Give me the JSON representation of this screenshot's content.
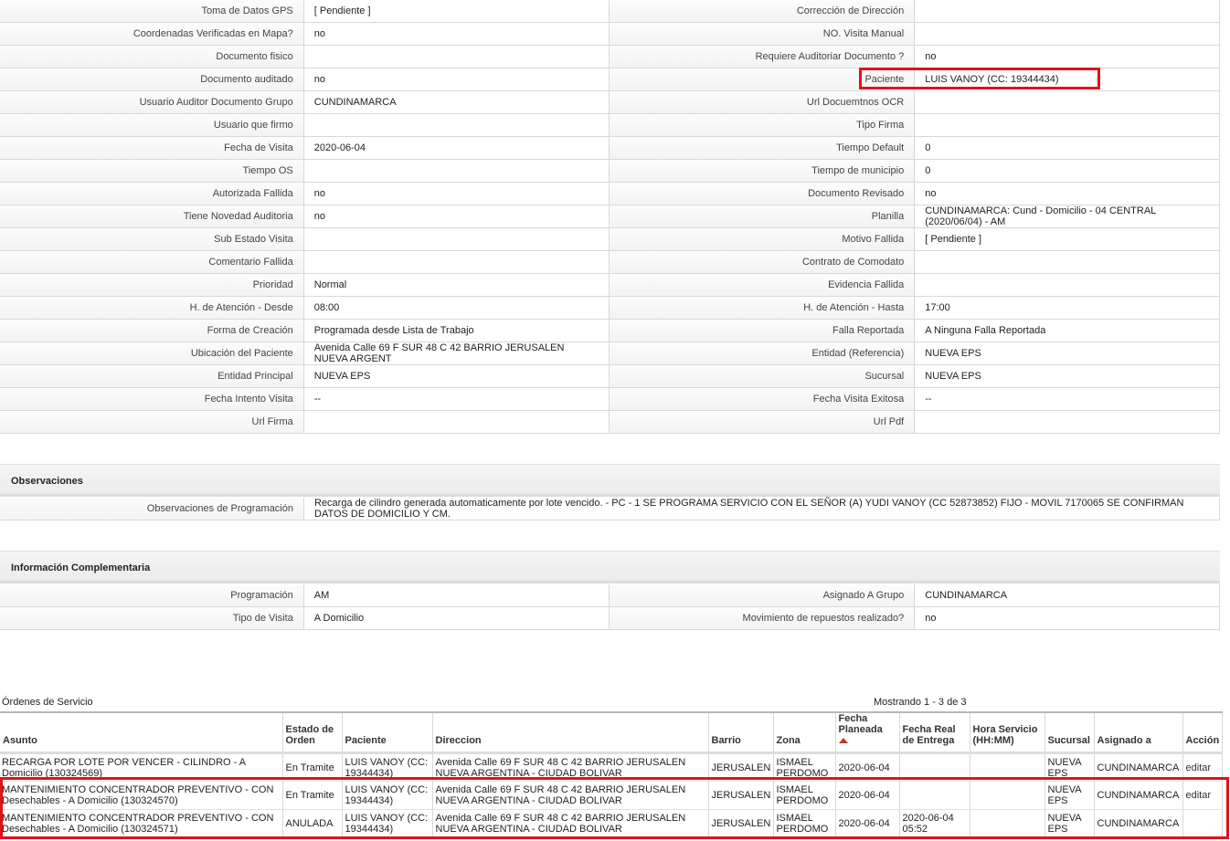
{
  "detail_rows": [
    {
      "l1": "Toma de Datos GPS",
      "v1": "[ Pendiente ]",
      "l2": "Corrección de Dirección",
      "v2": ""
    },
    {
      "l1": "Coordenadas Verificadas en Mapa?",
      "v1": " no",
      "l2": "NO. Visita Manual",
      "v2": ""
    },
    {
      "l1": "Documento fisico",
      "v1": "",
      "l2": "Requiere Auditoriar Documento ?",
      "v2": " no"
    },
    {
      "l1": "Documento auditado",
      "v1": " no",
      "l2": "Paciente",
      "v2": "LUIS VANOY (CC: 19344434)"
    },
    {
      "l1": "Usuario Auditor Documento Grupo",
      "v1": "CUNDINAMARCA",
      "l2": "Url Docuemtnos OCR",
      "v2": ""
    },
    {
      "l1": "Usuario que firmo",
      "v1": "",
      "l2": "Tipo Firma",
      "v2": ""
    },
    {
      "l1": "Fecha de Visita",
      "v1": " 2020-06-04",
      "l2": "Tiempo Default",
      "v2": "0"
    },
    {
      "l1": "Tiempo OS",
      "v1": "",
      "l2": "Tiempo de municipio",
      "v2": "0"
    },
    {
      "l1": "Autorizada Fallida",
      "v1": " no",
      "l2": "Documento Revisado",
      "v2": " no"
    },
    {
      "l1": "Tiene Novedad Auditoria",
      "v1": " no",
      "l2": "Planilla",
      "v2": "CUNDINAMARCA: Cund - Domicilio - 04 CENTRAL\n(2020/06/04) - AM"
    },
    {
      "l1": "Sub Estado Visita",
      "v1": "",
      "l2": "Motivo Fallida",
      "v2": "[ Pendiente ]"
    },
    {
      "l1": "Comentario Fallida",
      "v1": "",
      "l2": "Contrato de Comodato",
      "v2": ""
    },
    {
      "l1": "Prioridad",
      "v1": "Normal",
      "l2": "Evidencia Fallida",
      "v2": ""
    },
    {
      "l1": "H. de Atención - Desde",
      "v1": "08:00",
      "l2": "H. de Atención - Hasta",
      "v2": "17:00"
    },
    {
      "l1": "Forma de Creación",
      "v1": "Programada desde Lista de Trabajo",
      "l2": "Falla Reportada",
      "v2": "A Ninguna Falla Reportada"
    },
    {
      "l1": "Ubicación del Paciente",
      "v1": "Avenida Calle 69 F SUR 48 C 42 BARRIO JERUSALEN\nNUEVA ARGENT",
      "l2": "Entidad (Referencia)",
      "v2": "NUEVA EPS"
    },
    {
      "l1": "Entidad Principal",
      "v1": "NUEVA EPS",
      "l2": "Sucursal",
      "v2": "NUEVA EPS"
    },
    {
      "l1": "Fecha Intento Visita",
      "v1": " --",
      "l2": "Fecha Visita Exitosa",
      "v2": " --"
    },
    {
      "l1": "Url Firma",
      "v1": "",
      "l2": "Url Pdf",
      "v2": ""
    }
  ],
  "observaciones": {
    "title": "Observaciones",
    "label": "Observaciones de Programación",
    "value": "   Recarga de cilindro generada automaticamente por lote vencido. - PC - 1 SE PROGRAMA SERVICIO CON EL SEÑOR (A) YUDI VANOY (CC 52873852) FIJO - MOVIL 7170065 SE CONFIRMAN DATOS DE DOMICILIO Y CM."
  },
  "complementaria": {
    "title": "Información Complementaria",
    "rows": [
      {
        "l1": "Programación",
        "v1": "AM",
        "l2": "Asignado A Grupo",
        "v2": "CUNDINAMARCA"
      },
      {
        "l1": "Tipo de Visita",
        "v1": "A Domicilio",
        "l2": "Movimiento de repuestos realizado?",
        "v2": " no"
      }
    ]
  },
  "orders": {
    "title": "Órdenes de Servicio",
    "count_text": "Mostrando 1 - 3 de 3",
    "columns": [
      "Asunto",
      "Estado de Orden",
      "Paciente",
      "Direccion",
      "Barrio",
      "Zona",
      "Fecha Planeada",
      "Fecha Real de Entrega",
      "Hora Servicio (HH:MM)",
      "Sucursal",
      "Asignado a",
      "Acción"
    ],
    "rows": [
      {
        "asunto": "RECARGA POR LOTE POR VENCER - CILINDRO - A Domicilio (130324569)",
        "estado": "En Tramite",
        "paciente": "LUIS VANOY (CC: 19344434)",
        "direccion": "Avenida Calle 69 F SUR 48 C 42 BARRIO JERUSALEN NUEVA ARGENTINA - CIUDAD BOLIVAR",
        "barrio": "JERUSALEN",
        "zona": "ISMAEL PERDOMO",
        "fecha_planeada": "2020-06-04",
        "fecha_real": "",
        "hora": "",
        "sucursal": "NUEVA EPS",
        "asignado": "CUNDINAMARCA",
        "accion": "editar"
      },
      {
        "asunto": "MANTENIMIENTO CONCENTRADOR PREVENTIVO - CON Desechables - A Domicilio (130324570)",
        "estado": "En Tramite",
        "paciente": "LUIS VANOY (CC: 19344434)",
        "direccion": "Avenida Calle 69 F SUR 48 C 42 BARRIO JERUSALEN NUEVA ARGENTINA - CIUDAD BOLIVAR",
        "barrio": "JERUSALEN",
        "zona": "ISMAEL PERDOMO",
        "fecha_planeada": "2020-06-04",
        "fecha_real": "",
        "hora": "",
        "sucursal": "NUEVA EPS",
        "asignado": "CUNDINAMARCA",
        "accion": "editar"
      },
      {
        "asunto": "MANTENIMIENTO CONCENTRADOR PREVENTIVO - CON Desechables - A Domicilio (130324571)",
        "estado": "ANULADA",
        "paciente": "LUIS VANOY (CC: 19344434)",
        "direccion": "Avenida Calle 69 F SUR 48 C 42 BARRIO JERUSALEN NUEVA ARGENTINA - CIUDAD BOLIVAR",
        "barrio": "JERUSALEN",
        "zona": "ISMAEL PERDOMO",
        "fecha_planeada": "2020-06-04",
        "fecha_real": "2020-06-04 05:52",
        "hora": "",
        "sucursal": "NUEVA EPS",
        "asignado": "CUNDINAMARCA",
        "accion": ""
      }
    ]
  },
  "colors": {
    "highlight": "#e0121b",
    "sort_arrow": "#c0392b"
  }
}
